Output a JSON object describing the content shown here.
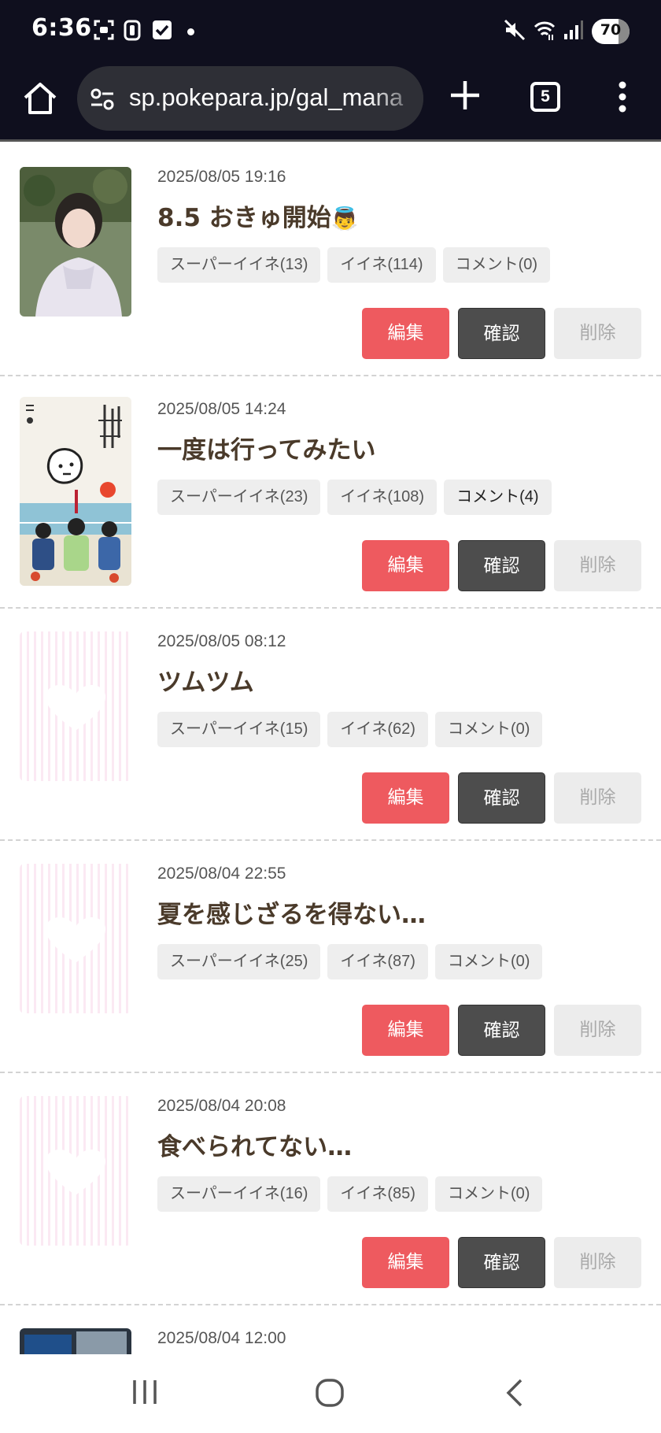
{
  "status_bar": {
    "time": "6:36",
    "battery": "70",
    "battery_level_percent": 70,
    "icons": [
      "screenshot-icon",
      "clipboard-icon",
      "checkbox-icon",
      "notification-dot-icon",
      "mute-icon",
      "wifi-icon",
      "signal-icon"
    ]
  },
  "browser": {
    "url": "sp.pokepara.jp/gal_mana",
    "tab_count": "5",
    "icons": [
      "home-icon",
      "site-settings-icon",
      "new-tab-icon",
      "tab-switcher-icon",
      "more-menu-icon"
    ]
  },
  "buttons": {
    "edit": "編集",
    "confirm": "確認",
    "delete": "削除"
  },
  "posts": [
    {
      "date": "2025/08/05 19:16",
      "title": "8.5 おきゅ開始",
      "emoji": "👼",
      "thumbnail": "photo",
      "super_like": "スーパーイイネ(13)",
      "like": "イイネ(114)",
      "comment": "コメント(0)"
    },
    {
      "date": "2025/08/05 14:24",
      "title": "一度は行ってみたい",
      "thumbnail": "illustration",
      "super_like": "スーパーイイネ(23)",
      "like": "イイネ(108)",
      "comment": "コメント(4)"
    },
    {
      "date": "2025/08/05 08:12",
      "title": "ツムツム",
      "thumbnail": "placeholder",
      "super_like": "スーパーイイネ(15)",
      "like": "イイネ(62)",
      "comment": "コメント(0)"
    },
    {
      "date": "2025/08/04 22:55",
      "title": "夏を感じざるを得ない…",
      "thumbnail": "placeholder",
      "super_like": "スーパーイイネ(25)",
      "like": "イイネ(87)",
      "comment": "コメント(0)"
    },
    {
      "date": "2025/08/04 20:08",
      "title": "食べられてない…",
      "thumbnail": "placeholder",
      "super_like": "スーパーイイネ(16)",
      "like": "イイネ(85)",
      "comment": "コメント(0)"
    },
    {
      "date": "2025/08/04 12:00",
      "thumbnail": "photo"
    }
  ],
  "nav_bar": {
    "icons": [
      "recents-icon",
      "home-circle-icon",
      "back-icon"
    ]
  },
  "colors": {
    "edit": "#ee5a5f",
    "confirm": "#4d4d4d",
    "delete": "#ececec",
    "title": "#4a3a2a",
    "header_bg": "#0f0f1e"
  }
}
